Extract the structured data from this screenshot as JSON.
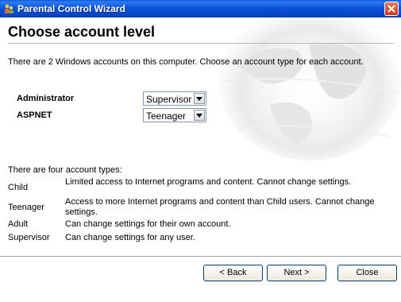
{
  "window": {
    "title": "Parental Control Wizard",
    "icon": "parental-control-icon",
    "close_icon": "close-icon"
  },
  "page": {
    "heading": "Choose account level",
    "intro": "There are 2 Windows accounts on this computer. Choose an account type for each account."
  },
  "accounts": [
    {
      "name": "Administrator",
      "level": "Supervisor"
    },
    {
      "name": "ASPNET",
      "level": "Teenager"
    }
  ],
  "types": {
    "header": "There are four account types:",
    "items": [
      {
        "name": "Child",
        "desc": "Limited access to Internet programs and content. Cannot change settings."
      },
      {
        "name": "Teenager",
        "desc": "Access to more Internet programs and content than Child users. Cannot change settings."
      },
      {
        "name": "Adult",
        "desc": "Can change settings for their own account."
      },
      {
        "name": "Supervisor",
        "desc": "Can change settings for any user."
      }
    ]
  },
  "buttons": {
    "back": "< Back",
    "next": "Next >",
    "close": "Close"
  }
}
